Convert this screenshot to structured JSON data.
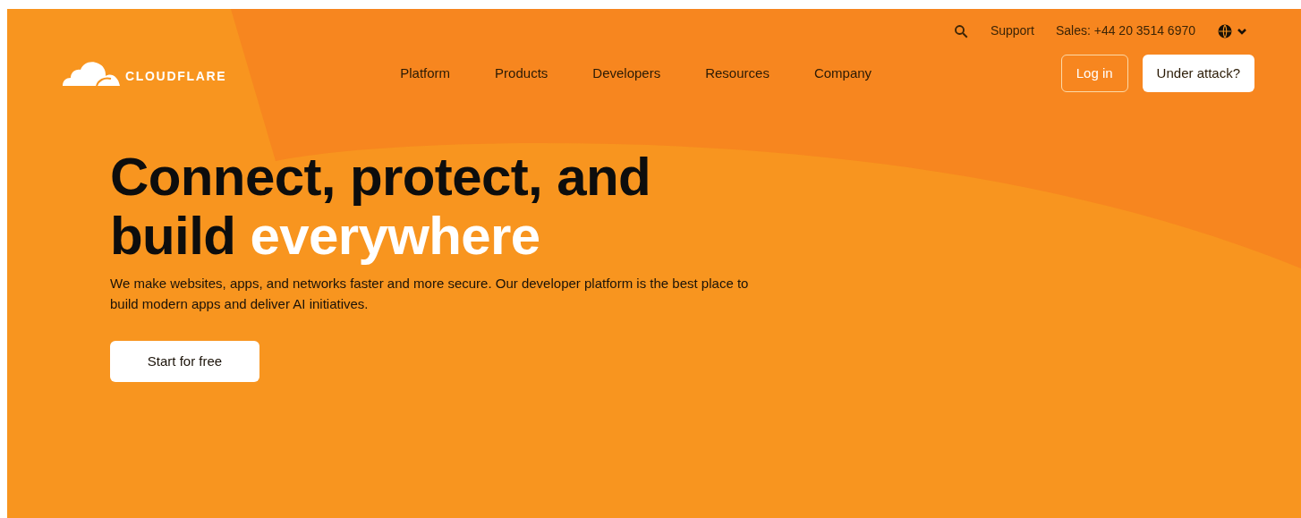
{
  "top_bar": {
    "support": "Support",
    "sales": "Sales: +44 20 3514 6970"
  },
  "logo": {
    "text": "CLOUDFLARE"
  },
  "nav": [
    {
      "label": "Platform"
    },
    {
      "label": "Products"
    },
    {
      "label": "Developers"
    },
    {
      "label": "Resources"
    },
    {
      "label": "Company"
    }
  ],
  "actions": {
    "login": "Log in",
    "under_attack": "Under attack?"
  },
  "hero": {
    "headline_line1": "Connect, protect, and",
    "headline_line2": "build",
    "headline_highlight": "everywhere",
    "subtitle": "We make websites, apps, and networks faster and more secure. Our developer platform is the best place to build modern apps and deliver AI initiatives.",
    "cta": "Start for free"
  }
}
